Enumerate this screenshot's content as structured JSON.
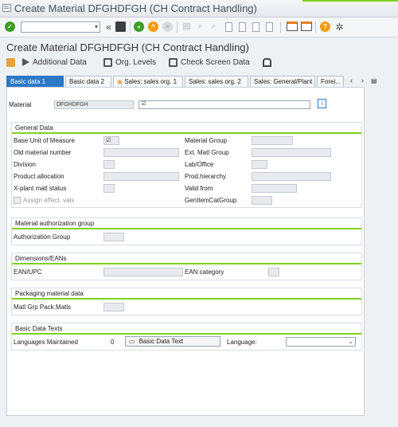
{
  "window": {
    "title": "Create Material DFGHDFGH (CH Contract Handling)"
  },
  "page": {
    "title": "Create Material DFGHDFGH (CH Contract Handling)"
  },
  "appbar": {
    "additional_data": "Additional Data",
    "org_levels": "Org. Levels",
    "check_screen_data": "Check Screen Data"
  },
  "tabs": [
    {
      "label": "Basic data 1"
    },
    {
      "label": "Basic data 2"
    },
    {
      "label": "Sales: sales org. 1"
    },
    {
      "label": "Sales: sales org. 2"
    },
    {
      "label": "Sales: General/Plant"
    },
    {
      "label": "Forei..."
    }
  ],
  "material": {
    "label": "Material",
    "value": "DFGHDFGH"
  },
  "general_data": {
    "title": "General Data",
    "base_uom": "Base Unit of Measure",
    "old_material_number": "Old material number",
    "division": "Division",
    "product_allocation": "Product allocation",
    "xplant_status": "X-plant matl status",
    "assign_effect_vals": "Assign effect. vals",
    "material_group": "Material Group",
    "ext_matl_group": "Ext. Matl Group",
    "lab_office": "Lab/Office",
    "prod_hierarchy": "Prod.hierarchy",
    "valid_from": "Valid from",
    "gen_item_cat_group": "GenItemCatGroup"
  },
  "auth_group": {
    "title": "Material authorization group",
    "label": "Authorization Group"
  },
  "dimensions": {
    "title": "Dimensions/EANs",
    "ean_upc": "EAN/UPC",
    "ean_category": "EAN category"
  },
  "packaging": {
    "title": "Packaging material data",
    "matl_grp": "Matl Grp Pack.Matls"
  },
  "basic_texts": {
    "title": "Basic Data Texts",
    "languages_label": "Languages Maintained",
    "languages_count": "0",
    "button": "Basic Data Text",
    "language_label": "Language:"
  },
  "colors": {
    "accent": "#2c79c7",
    "group_line": "#7ed321"
  }
}
